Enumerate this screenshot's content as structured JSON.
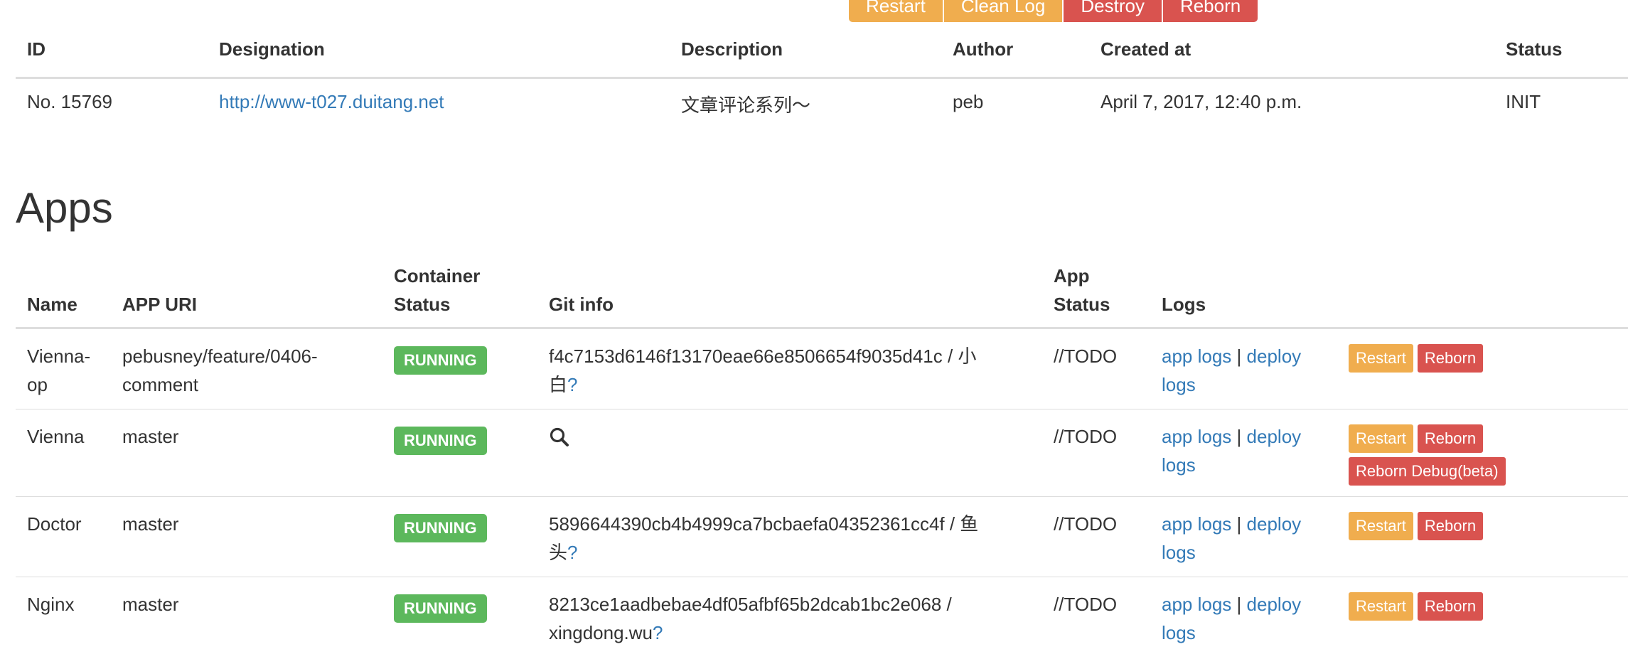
{
  "top_actions": {
    "restart": "Restart",
    "clean_log": "Clean Log",
    "destroy": "Destroy",
    "reborn": "Reborn"
  },
  "env_table": {
    "headers": [
      "ID",
      "Designation",
      "Description",
      "Author",
      "Created at",
      "Status"
    ],
    "row": {
      "id": "No. 15769",
      "designation": "http://www-t027.duitang.net",
      "description": "文章评论系列～",
      "author": "peb",
      "created_at": "April 7, 2017, 12:40 p.m.",
      "status": "INIT"
    }
  },
  "apps_section": {
    "title": "Apps",
    "headers": {
      "name": "Name",
      "app_uri": "APP URI",
      "container_status_1": "Container",
      "container_status_2": "Status",
      "git_info": "Git info",
      "app_status_1": "App",
      "app_status_2": "Status",
      "logs": "Logs"
    },
    "rows": [
      {
        "name_1": "Vienna-",
        "name_2": "op",
        "uri_1": "pebusney/feature/0406-",
        "uri_2": "comment",
        "container_status": "RUNNING",
        "git_1": "f4c7153d6146f13170eae66e8506654f9035d41c / 小",
        "git_2": "白",
        "git_q": "?",
        "app_status": "//TODO",
        "app_logs": "app logs",
        "sep": "|",
        "deploy_1": "deploy",
        "deploy_2": "logs",
        "restart": "Restart",
        "reborn": "Reborn"
      },
      {
        "name_1": "Vienna",
        "uri_1": "master",
        "container_status": "RUNNING",
        "git_icon": "search-icon",
        "app_status": "//TODO",
        "app_logs": "app logs",
        "sep": "|",
        "deploy_1": "deploy",
        "deploy_2": "logs",
        "restart": "Restart",
        "reborn": "Reborn",
        "reborn_debug": "Reborn Debug(beta)"
      },
      {
        "name_1": "Doctor",
        "uri_1": "master",
        "container_status": "RUNNING",
        "git_1": "5896644390cb4b4999ca7bcbaefa04352361cc4f / 鱼",
        "git_2": "头",
        "git_q": "?",
        "app_status": "//TODO",
        "app_logs": "app logs",
        "sep": "|",
        "deploy_1": "deploy",
        "deploy_2": "logs",
        "restart": "Restart",
        "reborn": "Reborn"
      },
      {
        "name_1": "Nginx",
        "uri_1": "master",
        "container_status": "RUNNING",
        "git_1": "8213ce1aadbebae4df05afbf65b2dcab1bc2e068 /",
        "git_2": "xingdong.wu",
        "git_q": "?",
        "app_status": "//TODO",
        "app_logs": "app logs",
        "sep": "|",
        "deploy_1": "deploy",
        "deploy_2": "logs",
        "restart": "Restart",
        "reborn": "Reborn"
      }
    ]
  },
  "colors": {
    "warning": "#f0ad4e",
    "danger": "#d9534f",
    "success": "#5cb85c",
    "link": "#337ab7"
  }
}
